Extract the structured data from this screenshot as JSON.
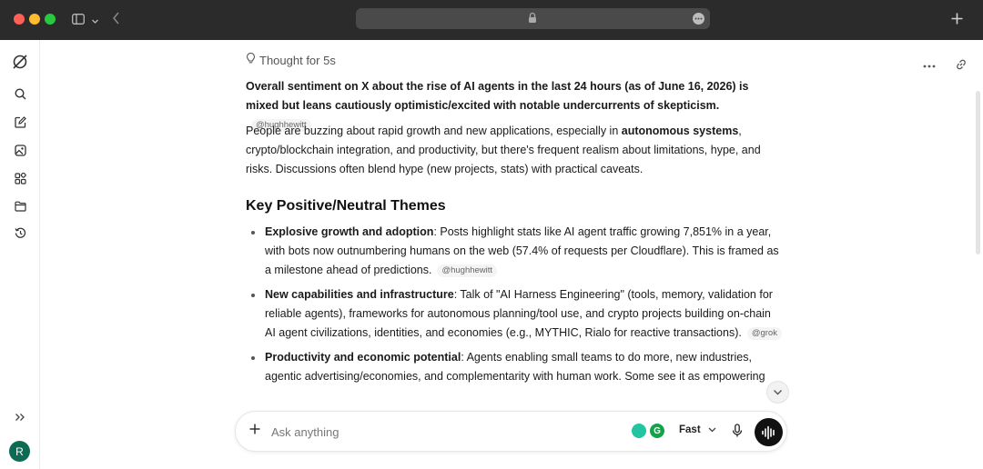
{
  "browser": {
    "url_lock": "lock-icon",
    "icons": [
      "sidebar-toggle-icon",
      "chevron-down-icon",
      "back-icon",
      "more-icon",
      "new-tab-icon"
    ]
  },
  "sidebar": {
    "items": [
      "logo-icon",
      "search-icon",
      "compose-icon",
      "image-icon",
      "apps-icon",
      "folder-icon",
      "history-icon"
    ],
    "expand_icon": "expand-icon",
    "avatar_initial": "R"
  },
  "thought": {
    "label": "Thought for 5s"
  },
  "response": {
    "summary_bold": "Overall sentiment on X about the rise of AI agents in the last 24 hours (as of June 16, 2026) is mixed but leans cautiously optimistic/excited with notable undercurrents of skepticism.",
    "summary_cite": "@hughhewitt",
    "intro_before": "People are buzzing about rapid growth and new applications, especially in ",
    "intro_bold": "autonomous systems",
    "intro_after": ", crypto/blockchain integration, and productivity, but there's frequent realism about limitations, hype, and risks. Discussions often blend hype (new projects, stats) with practical caveats.",
    "heading": "Key Positive/Neutral Themes",
    "bullets": [
      {
        "title": "Explosive growth and adoption",
        "text": ": Posts highlight stats like AI agent traffic growing 7,851% in a year, with bots now outnumbering humans on the web (57.4% of requests per Cloudflare). This is framed as a milestone ahead of predictions.",
        "cite": "@hughhewitt"
      },
      {
        "title": "New capabilities and infrastructure",
        "text": ": Talk of \"AI Harness Engineering\" (tools, memory, validation for reliable agents), frameworks for autonomous planning/tool use, and crypto projects building on-chain AI agent civilizations, identities, and economies (e.g., MYTHIC, Rialo for reactive transactions).",
        "cite": "@grok"
      },
      {
        "title": "Productivity and economic potential",
        "text": ": Agents enabling small teams to do more, new industries, agentic advertising/economies, and complementarity with human work. Some see it as empowering",
        "cite": ""
      }
    ]
  },
  "composer": {
    "placeholder": "Ask anything",
    "model": "Fast"
  }
}
